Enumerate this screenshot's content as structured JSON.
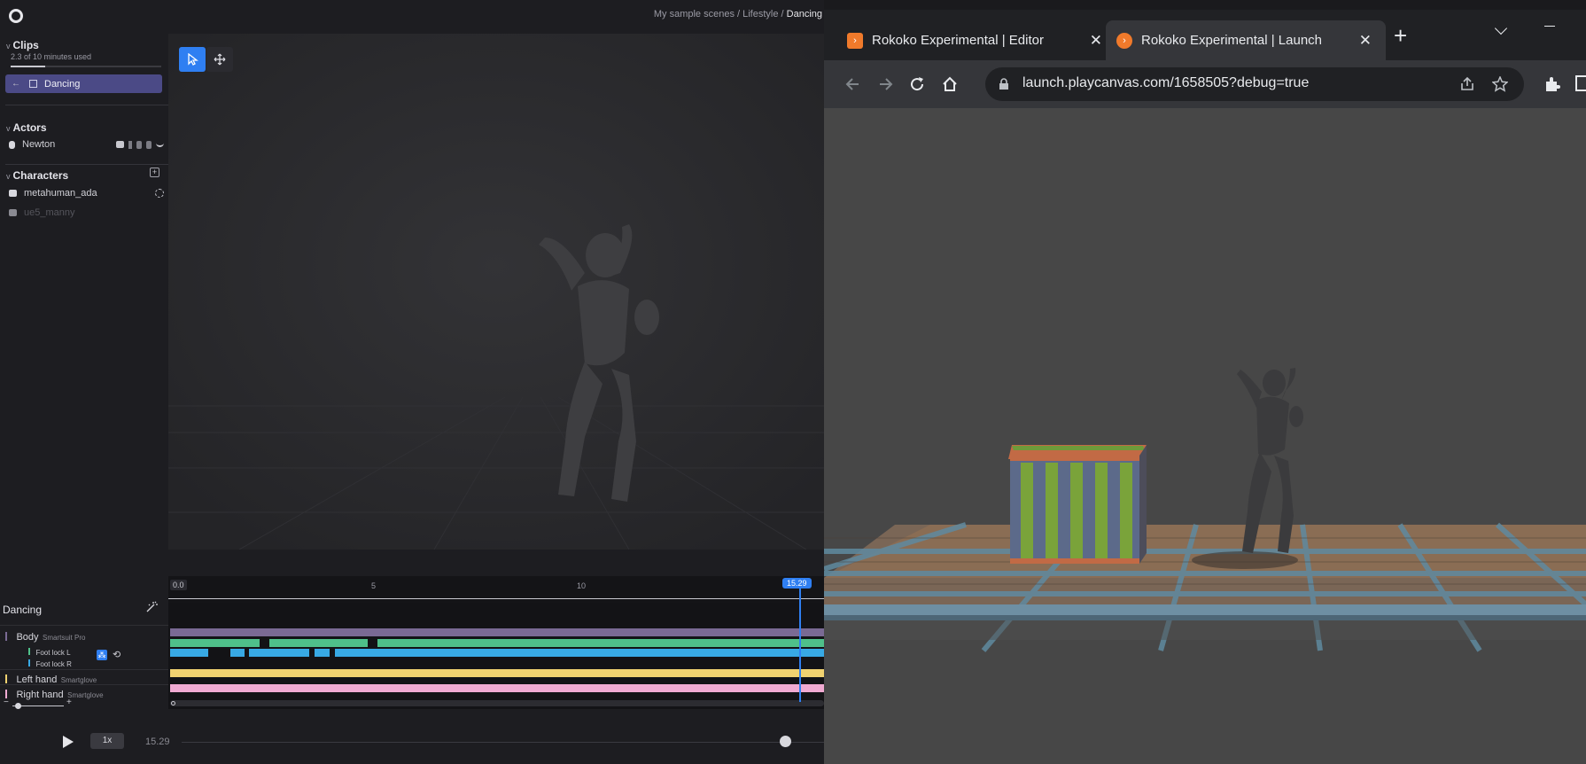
{
  "app": {
    "breadcrumb": "My sample scenes / Lifestyle / ",
    "breadcrumb_current": "Dancing",
    "clips": {
      "title": "Clips",
      "usage": "2.3 of 10 minutes used",
      "usage_fraction": 0.23,
      "selected_clip": "Dancing"
    },
    "actors": {
      "title": "Actors",
      "items": [
        {
          "name": "Newton"
        }
      ]
    },
    "characters": {
      "title": "Characters",
      "items": [
        {
          "name": "metahuman_ada"
        },
        {
          "name": "ue5_manny"
        }
      ]
    },
    "timeline": {
      "clip_name": "Dancing",
      "start_label": "0.0",
      "tick_5": "5",
      "tick_10": "10",
      "playhead_label": "15.29",
      "tracks": {
        "body": {
          "label": "Body",
          "device": "Smartsuit Pro"
        },
        "foot_lock_l": "Foot lock L",
        "foot_lock_r": "Foot lock R",
        "left_hand": {
          "label": "Left hand",
          "device": "Smartglove"
        },
        "right_hand": {
          "label": "Right hand",
          "device": "Smartglove"
        }
      },
      "colors": {
        "body": "#7a6a94",
        "foot_l": "#4fc08a",
        "foot_r": "#38a9e4",
        "left_hand": "#f1d270",
        "right_hand": "#f0aad2",
        "playhead": "#2f7ff2"
      }
    },
    "playback": {
      "speed": "1x",
      "time": "15.29",
      "zoom_minus": "−",
      "zoom_plus": "+"
    }
  },
  "browser": {
    "tabs": [
      {
        "title": "Rokoko Experimental | Editor",
        "active": false
      },
      {
        "title": "Rokoko Experimental | Launch",
        "active": true
      }
    ],
    "new_tab": "+",
    "url": "launch.playcanvas.com/1658505?debug=true",
    "icons": [
      "back-icon",
      "forward-icon",
      "reload-icon",
      "home-icon",
      "lock-icon",
      "share-icon",
      "star-icon",
      "extensions-icon"
    ]
  }
}
